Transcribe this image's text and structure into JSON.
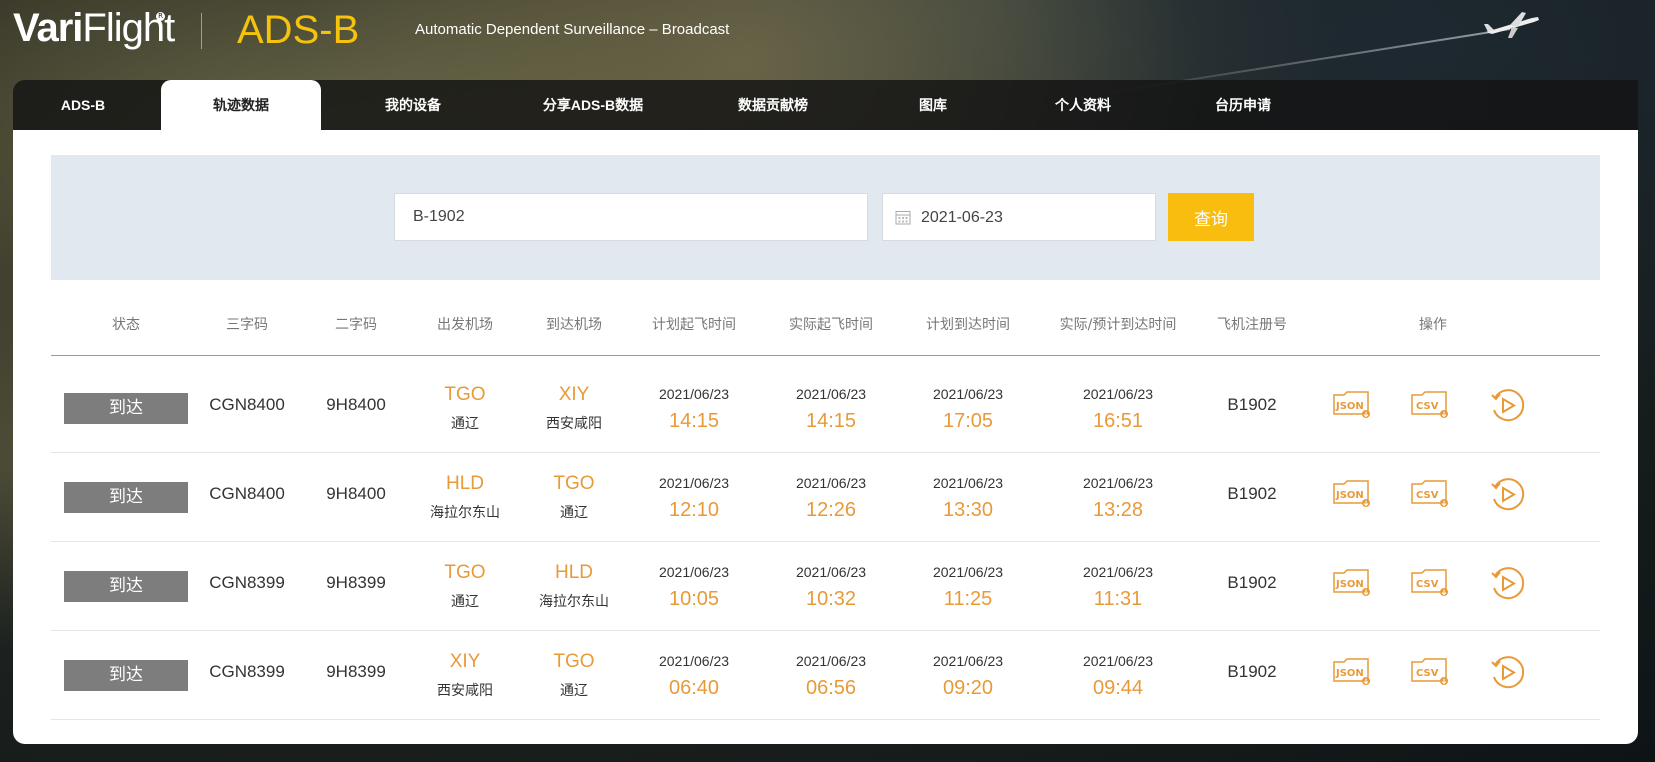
{
  "header": {
    "logo_part1": "Vari",
    "logo_part2": "Flight",
    "brand": "ADS-B",
    "subtitle": "Automatic Dependent Surveillance – Broadcast"
  },
  "nav": {
    "items": [
      {
        "label": "ADS-B"
      },
      {
        "label": "轨迹数据",
        "active": true
      },
      {
        "label": "我的设备"
      },
      {
        "label": "分享ADS-B数据"
      },
      {
        "label": "数据贡献榜"
      },
      {
        "label": "图库"
      },
      {
        "label": "个人资料"
      },
      {
        "label": "台历申请"
      }
    ]
  },
  "search": {
    "registration_value": "B-1902",
    "date_value": "2021-06-23",
    "query_label": "查询"
  },
  "table": {
    "headers": [
      "状态",
      "三字码",
      "二字码",
      "出发机场",
      "到达机场",
      "计划起飞时间",
      "实际起飞时间",
      "计划到达时间",
      "实际/预计到达时间",
      "飞机注册号",
      "操作"
    ],
    "rows": [
      {
        "status": "到达",
        "icao": "CGN8400",
        "iata": "9H8400",
        "dep_code": "TGO",
        "dep_name": "通辽",
        "arr_code": "XIY",
        "arr_name": "西安咸阳",
        "sched_dep_date": "2021/06/23",
        "sched_dep_time": "14:15",
        "act_dep_date": "2021/06/23",
        "act_dep_time": "14:15",
        "sched_arr_date": "2021/06/23",
        "sched_arr_time": "17:05",
        "act_arr_date": "2021/06/23",
        "act_arr_time": "16:51",
        "reg": "B1902"
      },
      {
        "status": "到达",
        "icao": "CGN8400",
        "iata": "9H8400",
        "dep_code": "HLD",
        "dep_name": "海拉尔东山",
        "arr_code": "TGO",
        "arr_name": "通辽",
        "sched_dep_date": "2021/06/23",
        "sched_dep_time": "12:10",
        "act_dep_date": "2021/06/23",
        "act_dep_time": "12:26",
        "sched_arr_date": "2021/06/23",
        "sched_arr_time": "13:30",
        "act_arr_date": "2021/06/23",
        "act_arr_time": "13:28",
        "reg": "B1902"
      },
      {
        "status": "到达",
        "icao": "CGN8399",
        "iata": "9H8399",
        "dep_code": "TGO",
        "dep_name": "通辽",
        "arr_code": "HLD",
        "arr_name": "海拉尔东山",
        "sched_dep_date": "2021/06/23",
        "sched_dep_time": "10:05",
        "act_dep_date": "2021/06/23",
        "act_dep_time": "10:32",
        "sched_arr_date": "2021/06/23",
        "sched_arr_time": "11:25",
        "act_arr_date": "2021/06/23",
        "act_arr_time": "11:31",
        "reg": "B1902"
      },
      {
        "status": "到达",
        "icao": "CGN8399",
        "iata": "9H8399",
        "dep_code": "XIY",
        "dep_name": "西安咸阳",
        "arr_code": "TGO",
        "arr_name": "通辽",
        "sched_dep_date": "2021/06/23",
        "sched_dep_time": "06:40",
        "act_dep_date": "2021/06/23",
        "act_dep_time": "06:56",
        "sched_arr_date": "2021/06/23",
        "sched_arr_time": "09:20",
        "act_arr_date": "2021/06/23",
        "act_arr_time": "09:44",
        "reg": "B1902"
      }
    ],
    "action_icons": [
      "json-download-icon",
      "csv-download-icon",
      "playback-icon"
    ]
  },
  "colors": {
    "brand_yellow": "#f5c20c",
    "button_yellow": "#f8bd0f",
    "accent_orange": "#e99a38",
    "status_gray": "#7d7d7d",
    "search_bg": "#e1e8f0"
  }
}
